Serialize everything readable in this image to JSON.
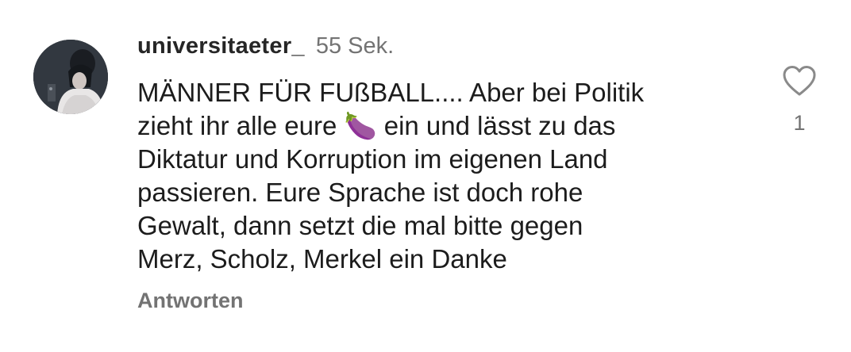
{
  "comment": {
    "username": "universitaeter_",
    "timestamp": "55 Sek.",
    "text": "MÄNNER FÜR FUßBALL.... Aber bei Politik\nzieht ihr alle eure 🍆 ein und lässt zu das\nDiktatur und Korruption im eigenen Land\npassieren. Eure Sprache ist doch rohe\nGewalt, dann setzt die mal bitte gegen\nMerz, Scholz, Merkel ein Danke",
    "reply_label": "Antworten",
    "like_count": "1"
  },
  "icons": {
    "like": "heart-outline-icon",
    "avatar": "user-avatar"
  },
  "colors": {
    "primary_text": "#1c1c1c",
    "secondary_text": "#737373",
    "icon_stroke": "#8a8a8a"
  }
}
